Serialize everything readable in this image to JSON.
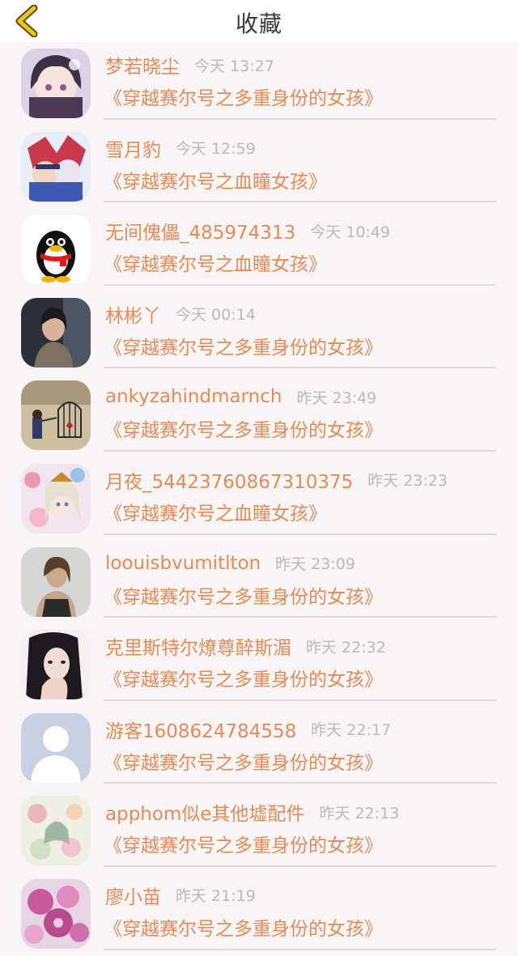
{
  "header": {
    "title": "收藏",
    "back_icon": "chevron-left-icon",
    "accent": "#f0c419"
  },
  "theme": {
    "name_color": "#e98a55",
    "time_color": "#b9b9b9"
  },
  "favorites": [
    {
      "name": "梦若晓尘",
      "time": "今天 13:27",
      "work": "《穿越赛尔号之多重身份的女孩》",
      "avatar": "anime-girl-avatar"
    },
    {
      "name": "雪月豹",
      "time": "今天 12:59",
      "work": "《穿越赛尔号之血瞳女孩》",
      "avatar": "anime-characters-avatar"
    },
    {
      "name": "无间傀儡_485974313",
      "time": "今天 10:49",
      "work": "《穿越赛尔号之血瞳女孩》",
      "avatar": "qq-penguin-avatar"
    },
    {
      "name": "林彬丫",
      "time": "今天 00:14",
      "work": "《穿越赛尔号之多重身份的女孩》",
      "avatar": "photo-girl-avatar"
    },
    {
      "name": "ankyzahindmarnch",
      "time": "昨天 23:49",
      "work": "《穿越赛尔号之多重身份的女孩》",
      "avatar": "birdcage-art-avatar"
    },
    {
      "name": "月夜_54423760867310375",
      "time": "昨天 23:23",
      "work": "《穿越赛尔号之血瞳女孩》",
      "avatar": "flower-anime-avatar"
    },
    {
      "name": "loouisbvumitlton",
      "time": "昨天 23:09",
      "work": "《穿越赛尔号之多重身份的女孩》",
      "avatar": "photo-woman-avatar"
    },
    {
      "name": "克里斯特尔燎尊醉斯湄",
      "time": "昨天 22:32",
      "work": "《穿越赛尔号之多重身份的女孩》",
      "avatar": "photo-girl-hand-avatar"
    },
    {
      "name": "游客1608624784558",
      "time": "昨天 22:17",
      "work": "《穿越赛尔号之多重身份的女孩》",
      "avatar": "default-user-avatar"
    },
    {
      "name": "apphom似e其他墟配件",
      "time": "昨天 22:13",
      "work": "《穿越赛尔号之多重身份的女孩》",
      "avatar": "floral-painting-avatar"
    },
    {
      "name": "廖小苗",
      "time": "昨天 21:19",
      "work": "《穿越赛尔号之多重身份的女孩》",
      "avatar": "pink-flowers-avatar"
    }
  ]
}
